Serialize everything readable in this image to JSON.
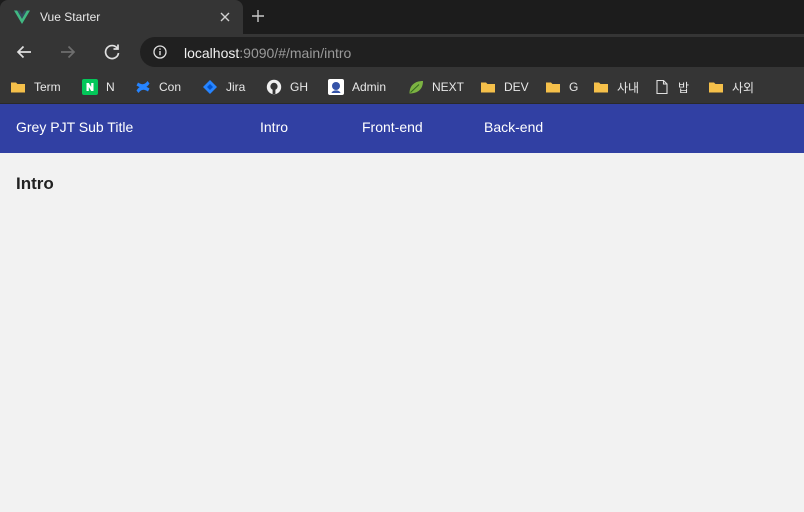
{
  "browser": {
    "tab": {
      "title": "Vue Starter",
      "favicon": "vue-logo-icon"
    },
    "toolbar": {
      "url_host": "localhost",
      "url_rest": ":9090/#/main/intro"
    },
    "bookmarks": [
      {
        "label": "Term",
        "icon": "folder-icon"
      },
      {
        "label": "N",
        "icon": "naver-icon"
      },
      {
        "label": "Con",
        "icon": "confluence-icon"
      },
      {
        "label": "Jira",
        "icon": "jira-icon"
      },
      {
        "label": "GH",
        "icon": "github-icon"
      },
      {
        "label": "Admin",
        "icon": "admin-icon"
      },
      {
        "label": "NEXT",
        "icon": "leaf-icon"
      },
      {
        "label": "DEV",
        "icon": "folder-icon"
      },
      {
        "label": "G",
        "icon": "folder-icon"
      },
      {
        "label": "사내",
        "icon": "folder-icon"
      },
      {
        "label": "밥",
        "icon": "file-icon"
      },
      {
        "label": "사외",
        "icon": "folder-icon"
      }
    ]
  },
  "app": {
    "title": "Grey PJT Sub Title",
    "nav": [
      "Intro",
      "Front-end",
      "Back-end"
    ],
    "header_color": "#3140a3"
  },
  "page": {
    "heading": "Intro"
  }
}
